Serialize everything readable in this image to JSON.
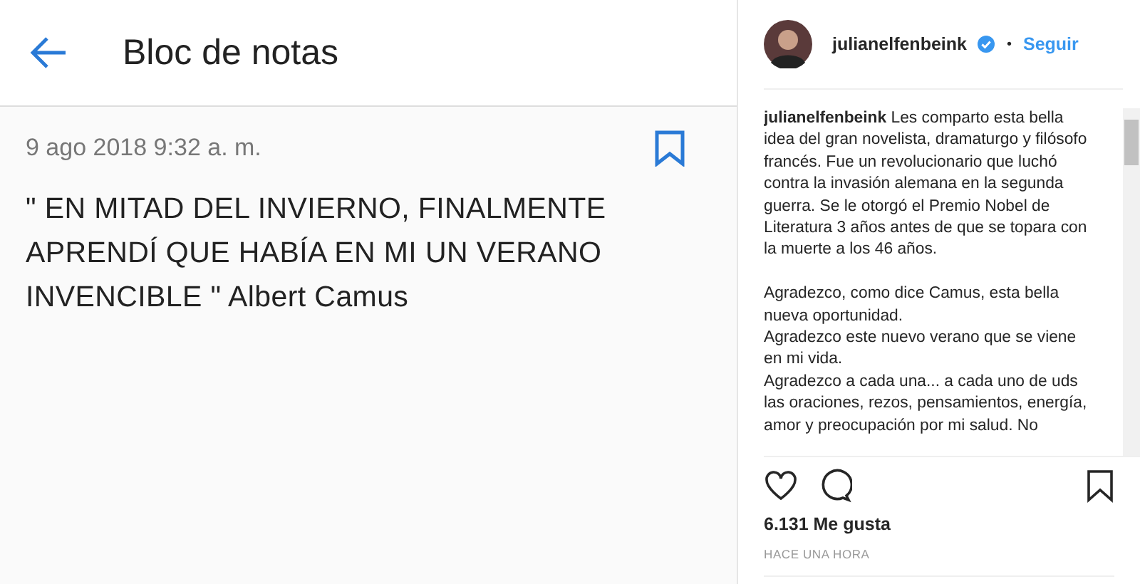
{
  "note": {
    "title": "Bloc de notas",
    "date": "9 ago 2018 9:32 a. m.",
    "body": "\" EN MITAD DEL INVIERNO, FINALMENTE APRENDÍ QUE HABÍA EN MI UN VERANO INVENCIBLE \" Albert Camus"
  },
  "post": {
    "username": "julianelfenbeink",
    "verified": true,
    "separator": "•",
    "follow": "Seguir",
    "caption": [
      {
        "paragraphs": [
          "**julianelfenbeink** Les comparto esta bella idea del gran novelista, dramaturgo y filósofo francés. Fue un revolucionario que luchó contra la invasión alemana en la segunda guerra. Se le otorgó el Premio Nobel de Literatura 3 años antes de que se topara con la muerte a los 46 años."
        ]
      },
      {
        "paragraphs": [
          "Agradezco, como dice Camus, esta bella nueva oportunidad.",
          "Agradezco este nuevo verano que se viene en mi vida.",
          "Agradezco a cada una... a cada uno de uds las oraciones, rezos, pensamientos, energía, amor y preocupación por mi salud. No"
        ]
      }
    ],
    "likes": "6.131 Me gusta",
    "time": "HACE UNA HORA"
  }
}
